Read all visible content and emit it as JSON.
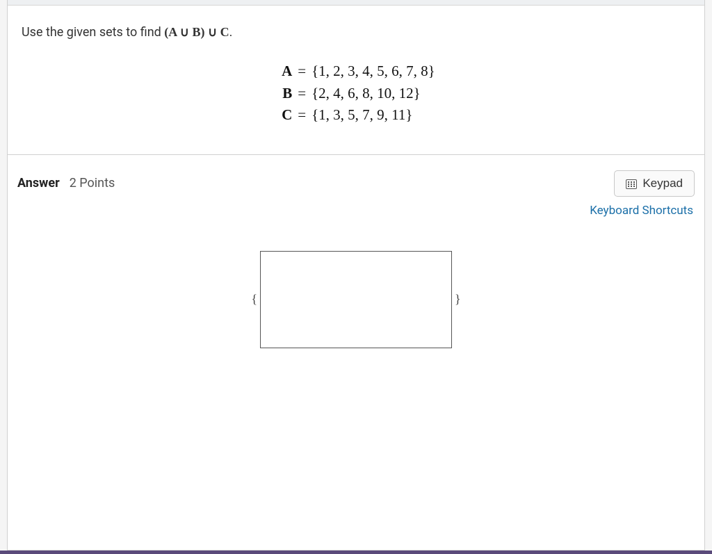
{
  "question": {
    "prompt_prefix": "Use the given sets to find ",
    "expression": "(A ∪ B) ∪ C",
    "prompt_suffix": ".",
    "sets": [
      {
        "name": "A",
        "value": "{1, 2, 3, 4, 5, 6, 7, 8}"
      },
      {
        "name": "B",
        "value": "{2, 4, 6, 8, 10, 12}"
      },
      {
        "name": "C",
        "value": "{1, 3, 5, 7, 9, 11}"
      }
    ]
  },
  "answer": {
    "label": "Answer",
    "points": "2 Points",
    "keypad_label": "Keypad",
    "shortcuts_label": "Keyboard Shortcuts",
    "left_brace": "{",
    "right_brace": "}",
    "input_value": ""
  }
}
